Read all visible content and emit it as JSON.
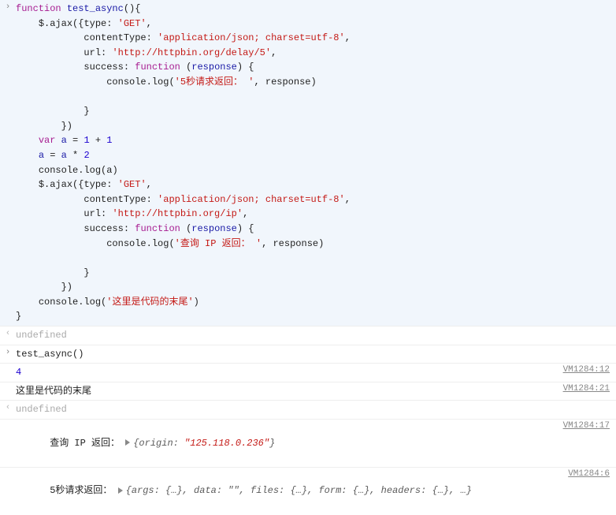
{
  "code": {
    "lines": [
      [
        [
          "kw",
          "function"
        ],
        [
          "sp",
          " "
        ],
        [
          "fn",
          "test_async"
        ],
        [
          "op",
          "(){"
        ]
      ],
      [
        [
          "sp",
          "    "
        ],
        [
          "id",
          "$"
        ],
        [
          "op",
          "."
        ],
        [
          "id",
          "ajax"
        ],
        [
          "op",
          "({"
        ],
        [
          "id",
          "type"
        ],
        [
          "op",
          ": "
        ],
        [
          "str",
          "'GET'"
        ],
        [
          "op",
          ","
        ]
      ],
      [
        [
          "sp",
          "            "
        ],
        [
          "id",
          "contentType"
        ],
        [
          "op",
          ": "
        ],
        [
          "str",
          "'application/json; charset=utf-8'"
        ],
        [
          "op",
          ","
        ]
      ],
      [
        [
          "sp",
          "            "
        ],
        [
          "id",
          "url"
        ],
        [
          "op",
          ": "
        ],
        [
          "str",
          "'http://httpbin.org/delay/5'"
        ],
        [
          "op",
          ","
        ]
      ],
      [
        [
          "sp",
          "            "
        ],
        [
          "id",
          "success"
        ],
        [
          "op",
          ": "
        ],
        [
          "kw",
          "function"
        ],
        [
          "sp",
          " "
        ],
        [
          "op",
          "("
        ],
        [
          "fn",
          "response"
        ],
        [
          "op",
          ") {"
        ]
      ],
      [
        [
          "sp",
          "                "
        ],
        [
          "id",
          "console"
        ],
        [
          "op",
          "."
        ],
        [
          "id",
          "log"
        ],
        [
          "op",
          "("
        ],
        [
          "str",
          "'5秒请求返回： '"
        ],
        [
          "op",
          ", "
        ],
        [
          "id",
          "response"
        ],
        [
          "op",
          ")"
        ]
      ],
      [
        [
          "sp",
          ""
        ]
      ],
      [
        [
          "sp",
          "            "
        ],
        [
          "op",
          "}"
        ]
      ],
      [
        [
          "sp",
          "        "
        ],
        [
          "op",
          "})"
        ]
      ],
      [
        [
          "sp",
          "    "
        ],
        [
          "kw",
          "var"
        ],
        [
          "sp",
          " "
        ],
        [
          "fn",
          "a"
        ],
        [
          "op",
          " = "
        ],
        [
          "num",
          "1"
        ],
        [
          "op",
          " + "
        ],
        [
          "num",
          "1"
        ]
      ],
      [
        [
          "sp",
          "    "
        ],
        [
          "fn",
          "a"
        ],
        [
          "op",
          " = "
        ],
        [
          "fn",
          "a"
        ],
        [
          "op",
          " * "
        ],
        [
          "num",
          "2"
        ]
      ],
      [
        [
          "sp",
          "    "
        ],
        [
          "id",
          "console"
        ],
        [
          "op",
          "."
        ],
        [
          "id",
          "log"
        ],
        [
          "op",
          "("
        ],
        [
          "id",
          "a"
        ],
        [
          "op",
          ")"
        ]
      ],
      [
        [
          "sp",
          "    "
        ],
        [
          "id",
          "$"
        ],
        [
          "op",
          "."
        ],
        [
          "id",
          "ajax"
        ],
        [
          "op",
          "({"
        ],
        [
          "id",
          "type"
        ],
        [
          "op",
          ": "
        ],
        [
          "str",
          "'GET'"
        ],
        [
          "op",
          ","
        ]
      ],
      [
        [
          "sp",
          "            "
        ],
        [
          "id",
          "contentType"
        ],
        [
          "op",
          ": "
        ],
        [
          "str",
          "'application/json; charset=utf-8'"
        ],
        [
          "op",
          ","
        ]
      ],
      [
        [
          "sp",
          "            "
        ],
        [
          "id",
          "url"
        ],
        [
          "op",
          ": "
        ],
        [
          "str",
          "'http://httpbin.org/ip'"
        ],
        [
          "op",
          ","
        ]
      ],
      [
        [
          "sp",
          "            "
        ],
        [
          "id",
          "success"
        ],
        [
          "op",
          ": "
        ],
        [
          "kw",
          "function"
        ],
        [
          "sp",
          " "
        ],
        [
          "op",
          "("
        ],
        [
          "fn",
          "response"
        ],
        [
          "op",
          ") {"
        ]
      ],
      [
        [
          "sp",
          "                "
        ],
        [
          "id",
          "console"
        ],
        [
          "op",
          "."
        ],
        [
          "id",
          "log"
        ],
        [
          "op",
          "("
        ],
        [
          "str",
          "'查询 IP 返回： '"
        ],
        [
          "op",
          ", "
        ],
        [
          "id",
          "response"
        ],
        [
          "op",
          ")"
        ]
      ],
      [
        [
          "sp",
          ""
        ]
      ],
      [
        [
          "sp",
          "            "
        ],
        [
          "op",
          "}"
        ]
      ],
      [
        [
          "sp",
          "        "
        ],
        [
          "op",
          "})"
        ]
      ],
      [
        [
          "sp",
          "    "
        ],
        [
          "id",
          "console"
        ],
        [
          "op",
          "."
        ],
        [
          "id",
          "log"
        ],
        [
          "op",
          "("
        ],
        [
          "str",
          "'这里是代码的末尾'"
        ],
        [
          "op",
          ")"
        ]
      ],
      [
        [
          "op",
          "}"
        ]
      ]
    ]
  },
  "rows": {
    "undef1": "undefined",
    "call": "test_async()",
    "log_num": "4",
    "log_num_src": "VM1284:12",
    "log_tail": "这里是代码的末尾",
    "log_tail_src": "VM1284:21",
    "undef2": "undefined",
    "ip_label": "查询 IP 返回： ",
    "ip_obj_prefix": "{origin: ",
    "ip_obj_value": "\"125.118.0.236\"",
    "ip_obj_suffix": "}",
    "ip_src": "VM1284:17",
    "delay_label": "5秒请求返回： ",
    "delay_obj": "{args: {…}, data: \"\", files: {…}, form: {…}, headers: {…}, …}",
    "delay_src": "VM1284:6"
  }
}
